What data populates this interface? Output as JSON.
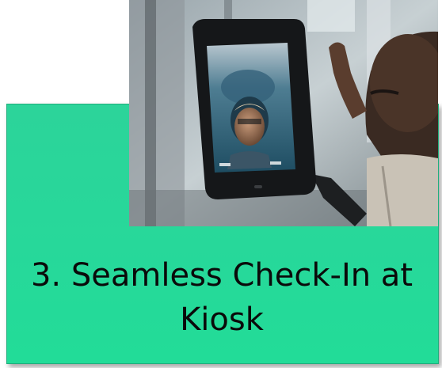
{
  "card": {
    "title_line1": "3. Seamless Check-In at",
    "title_line2": "Kiosk",
    "background_color": "#27d89a"
  },
  "photo": {
    "subject": "person-facing-face-scanning-kiosk",
    "device": "tablet-kiosk-icon"
  }
}
